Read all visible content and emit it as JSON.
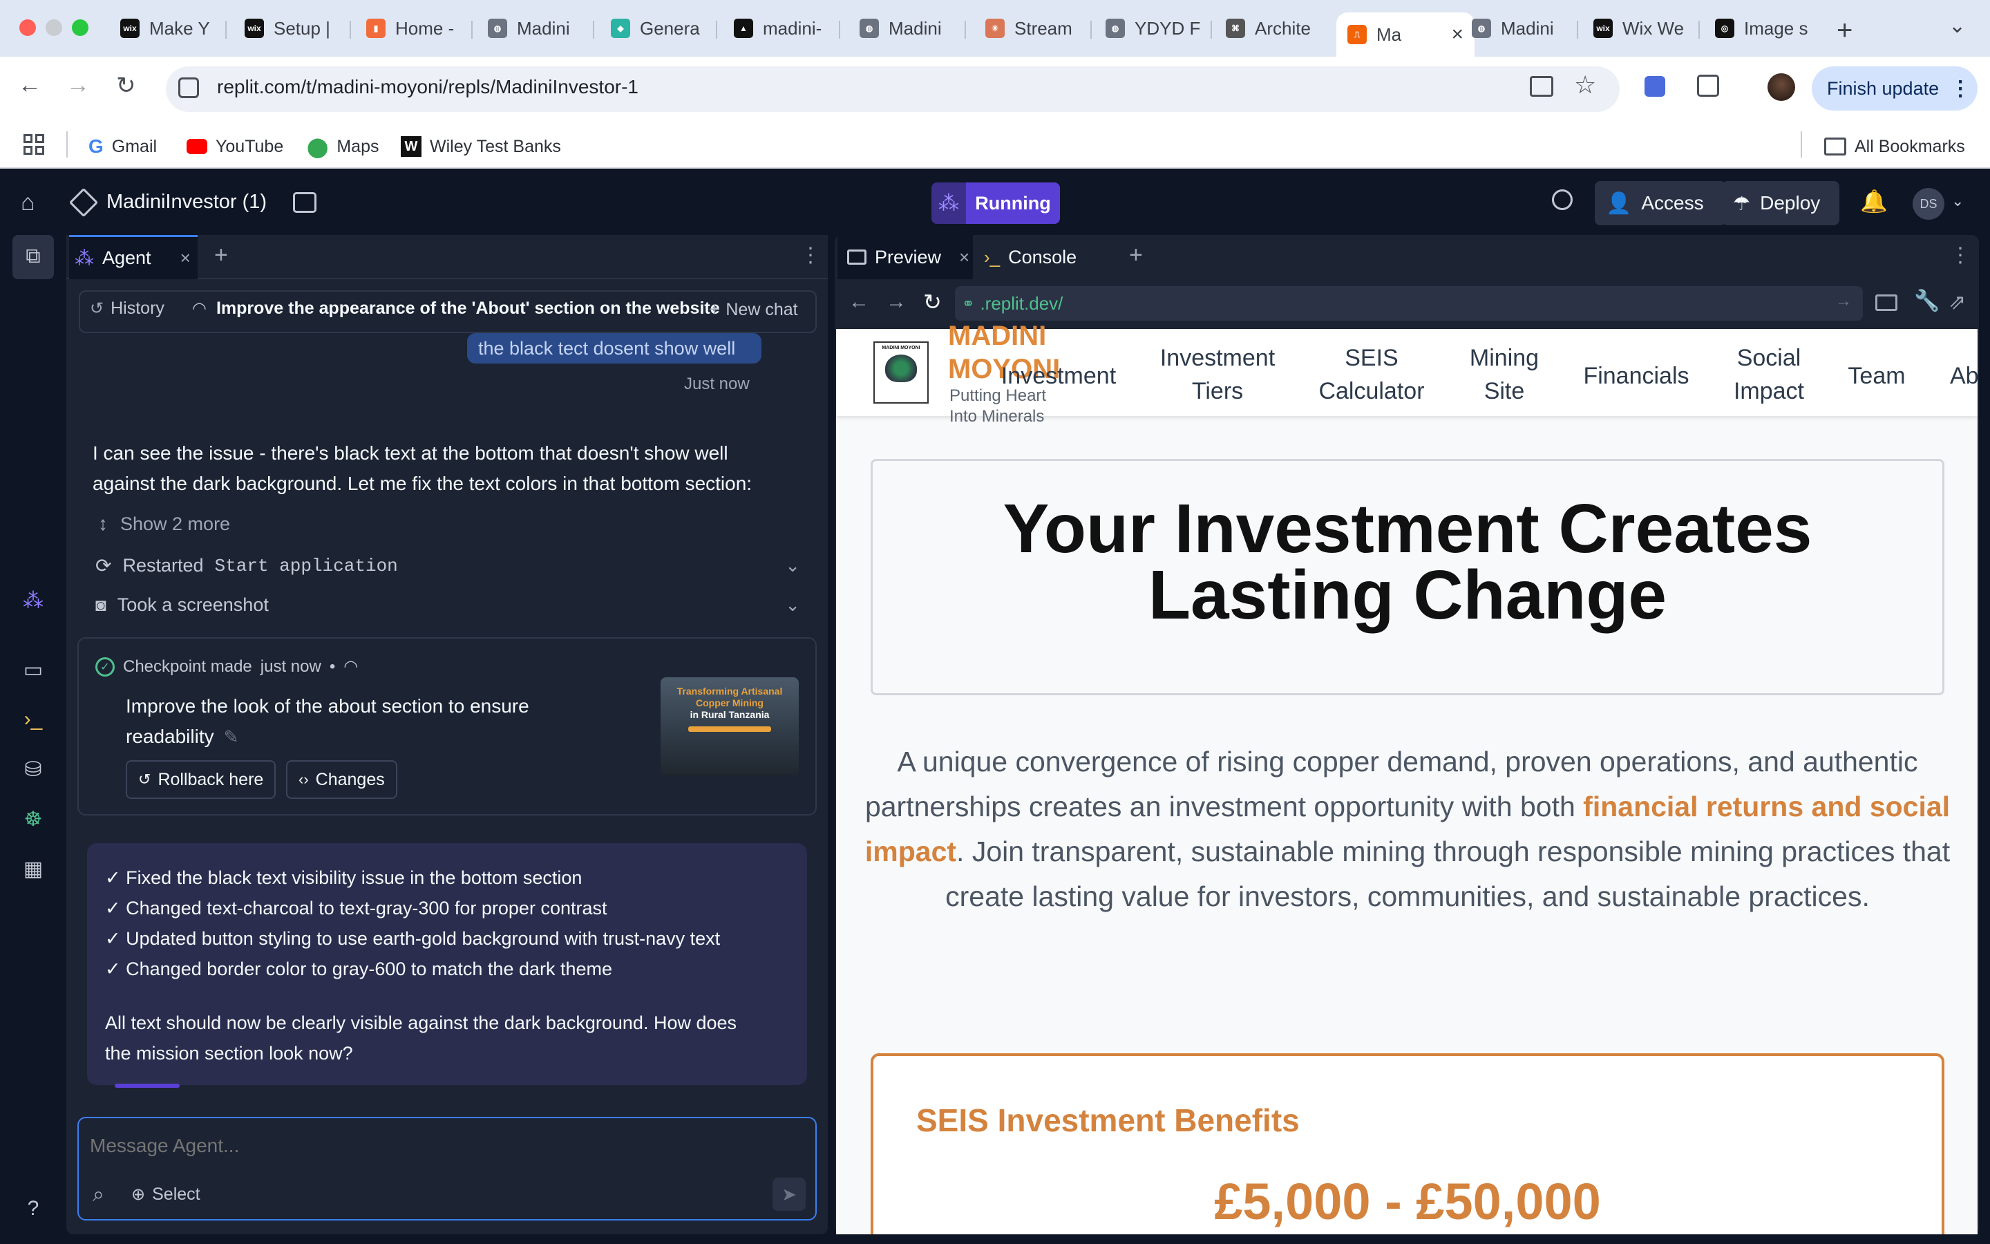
{
  "browser": {
    "tabs": [
      {
        "label": "Make Y",
        "icon": "wix-icon"
      },
      {
        "label": "Setup |",
        "icon": "wix-icon"
      },
      {
        "label": "Home -",
        "icon": "site-icon"
      },
      {
        "label": "Madini",
        "icon": "globe-icon"
      },
      {
        "label": "Genera",
        "icon": "diamond-icon"
      },
      {
        "label": "madini-",
        "icon": "triangle-icon"
      },
      {
        "label": "Madini",
        "icon": "globe-icon"
      },
      {
        "label": "Stream",
        "icon": "asterisk-icon"
      },
      {
        "label": "YDYD F",
        "icon": "globe-icon"
      },
      {
        "label": "Archite",
        "icon": "knot-icon"
      },
      {
        "label": "Ma",
        "icon": "replit-icon",
        "active": true
      },
      {
        "label": "Madini",
        "icon": "globe-icon"
      },
      {
        "label": "Wix We",
        "icon": "wix-icon"
      },
      {
        "label": "Image s",
        "icon": "openai-icon"
      }
    ],
    "url": "replit.com/t/madini-moyoni/repls/MadiniInvestor-1",
    "finish_update": "Finish update",
    "bookmarks": [
      {
        "label": "Gmail",
        "icon": "google-icon"
      },
      {
        "label": "YouTube",
        "icon": "youtube-icon"
      },
      {
        "label": "Maps",
        "icon": "maps-icon"
      },
      {
        "label": "Wiley Test Banks",
        "icon": "wiley-icon"
      }
    ],
    "all_bookmarks": "All Bookmarks"
  },
  "replit": {
    "project_name": "MadiniInvestor (1)",
    "running": "Running",
    "access": "Access",
    "deploy": "Deploy",
    "avatar": "DS"
  },
  "agent_panel": {
    "tab_label": "Agent",
    "history": "History",
    "chat_title": "Improve the appearance of the 'About' section on the website",
    "new_chat": "New chat",
    "user_message_fragment": "the black tect dosent show well",
    "just_now": "Just now",
    "agent_reply_line1": "I can see the issue - there's black text at the bottom that doesn't show well",
    "agent_reply_line2": "against the dark background. Let me fix the text colors in that bottom section:",
    "show_more": "Show 2 more",
    "restarted_prefix": "Restarted",
    "restarted_code": "Start application",
    "screenshot": "Took a screenshot",
    "checkpoint_label": "Checkpoint made",
    "checkpoint_time": "just now",
    "checkpoint_desc_line1": "Improve the look of the about section to ensure",
    "checkpoint_desc_line2": "readability",
    "rollback": "Rollback here",
    "changes": "Changes",
    "thumb_title_line1": "Transforming Artisanal",
    "thumb_title_line2": "Copper Mining",
    "thumb_title_line3": "in Rural Tanzania",
    "summary": [
      "✓ Fixed the black text visibility issue in the bottom section",
      "✓ Changed text-charcoal to text-gray-300 for proper contrast",
      "✓ Updated button styling to use earth-gold background with trust-navy text",
      "✓ Changed border color to gray-600 to match the dark theme"
    ],
    "closing_line1": "All text should now be clearly visible against the dark background. How does",
    "closing_line2": "the mission section look now?",
    "composer_placeholder": "Message Agent...",
    "select": "Select"
  },
  "preview_panel": {
    "tab_preview": "Preview",
    "tab_console": "Console",
    "url": ".replit.dev/"
  },
  "website": {
    "brand_line1": "MADINI",
    "brand_line2": "MOYONI",
    "tagline_line1": "Putting Heart",
    "tagline_line2": "Into Minerals",
    "logo_text": "MADINI MOYONI",
    "nav": [
      {
        "line1": "Investment",
        "line2": ""
      },
      {
        "line1": "Investment",
        "line2": "Tiers"
      },
      {
        "line1": "SEIS",
        "line2": "Calculator"
      },
      {
        "line1": "Mining",
        "line2": "Site"
      },
      {
        "line1": "Financials",
        "line2": ""
      },
      {
        "line1": "Social",
        "line2": "Impact"
      },
      {
        "line1": "Team",
        "line2": ""
      },
      {
        "line1": "Ab",
        "line2": ""
      }
    ],
    "hero_title_line1": "Your Investment Creates",
    "hero_title_line2": "Lasting Change",
    "para_before": "A unique convergence of rising copper demand, proven operations, and authentic partnerships creates an investment opportunity with both ",
    "para_highlight": "financial returns and social impact",
    "para_after": ". Join transparent, sustainable mining through responsible mining practices that create lasting value for investors, communities, and sustainable practices.",
    "seis_title": "SEIS Investment Benefits",
    "seis_amount": "£5,000 - £50,000"
  },
  "colors": {
    "replit_bg": "#0e1525",
    "panel_bg": "#1c2333",
    "running_purple": "#5a3fd6",
    "accent_orange": "#d4833e",
    "agent_msg_bg": "#2a2d4d"
  }
}
